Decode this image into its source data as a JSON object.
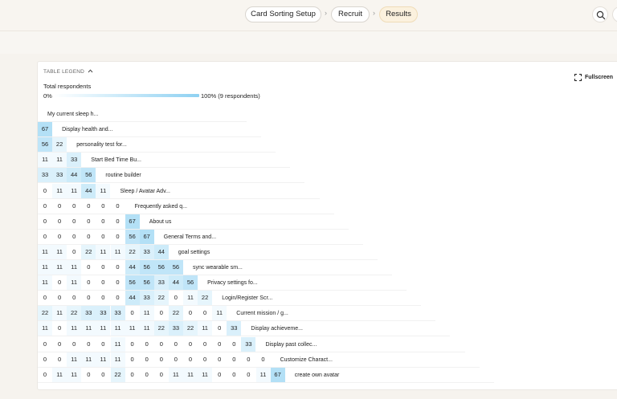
{
  "nav": {
    "steps": [
      {
        "label": "Card Sorting Setup",
        "active": false
      },
      {
        "label": "Recruit",
        "active": false
      },
      {
        "label": "Results",
        "active": true
      }
    ],
    "chevron": "›",
    "search_icon": "search-icon"
  },
  "legend": {
    "toggle_label": "TABLE LEGEND",
    "respondents_label": "Total respondents",
    "min_label": "0%",
    "max_label": "100% (9 respondents)",
    "max_color": "#8ed1f2"
  },
  "fullscreen_label": "Fullscreen",
  "matrix": {
    "rows": [
      {
        "label": "My current sleep h...",
        "values": []
      },
      {
        "label": "Display health and...",
        "values": [
          "67"
        ]
      },
      {
        "label": "personality test for...",
        "values": [
          "56",
          "22"
        ]
      },
      {
        "label": "Start Bed Time Bu...",
        "values": [
          "11",
          "11",
          "33"
        ]
      },
      {
        "label": "routine builder",
        "values": [
          "33",
          "33",
          "44",
          "56"
        ]
      },
      {
        "label": "Sleep / Avatar Adv...",
        "values": [
          "0",
          "11",
          "11",
          "44",
          "11"
        ]
      },
      {
        "label": "Frequently asked q...",
        "values": [
          "0",
          "0",
          "0",
          "0",
          "0",
          "0"
        ]
      },
      {
        "label": "About us",
        "values": [
          "0",
          "0",
          "0",
          "0",
          "0",
          "0",
          "67"
        ]
      },
      {
        "label": "General Terms and...",
        "values": [
          "0",
          "0",
          "0",
          "0",
          "0",
          "0",
          "56",
          "67"
        ]
      },
      {
        "label": "goal settings",
        "values": [
          "11",
          "11",
          "0",
          "22",
          "11",
          "11",
          "22",
          "33",
          "44"
        ]
      },
      {
        "label": "sync wearable sm...",
        "values": [
          "11",
          "11",
          "11",
          "0",
          "0",
          "0",
          "44",
          "56",
          "56",
          "56"
        ]
      },
      {
        "label": "Privacy settings fo...",
        "values": [
          "11",
          "0",
          "11",
          "0",
          "0",
          "0",
          "56",
          "56",
          "33",
          "44",
          "56"
        ]
      },
      {
        "label": "Login/Register Scr...",
        "values": [
          "0",
          "0",
          "0",
          "0",
          "0",
          "0",
          "44",
          "33",
          "22",
          "0",
          "11",
          "22"
        ]
      },
      {
        "label": "Current mission / g...",
        "values": [
          "22",
          "11",
          "22",
          "33",
          "33",
          "33",
          "0",
          "11",
          "0",
          "22",
          "0",
          "0",
          "11"
        ]
      },
      {
        "label": "Display achieveme...",
        "values": [
          "11",
          "0",
          "11",
          "11",
          "11",
          "11",
          "11",
          "11",
          "22",
          "33",
          "22",
          "11",
          "0",
          "33"
        ]
      },
      {
        "label": "Display past collec...",
        "values": [
          "0",
          "0",
          "0",
          "0",
          "0",
          "11",
          "0",
          "0",
          "0",
          "0",
          "0",
          "0",
          "0",
          "0",
          "33"
        ]
      },
      {
        "label": "Customize Charact...",
        "values": [
          "0",
          "0",
          "11",
          "11",
          "11",
          "11",
          "0",
          "0",
          "0",
          "0",
          "0",
          "0",
          "0",
          "0",
          "0",
          "0"
        ]
      },
      {
        "label": "create own avatar",
        "values": [
          "0",
          "11",
          "11",
          "0",
          "0",
          "22",
          "0",
          "0",
          "0",
          "11",
          "11",
          "11",
          "0",
          "0",
          "0",
          "11",
          "67"
        ]
      }
    ]
  }
}
